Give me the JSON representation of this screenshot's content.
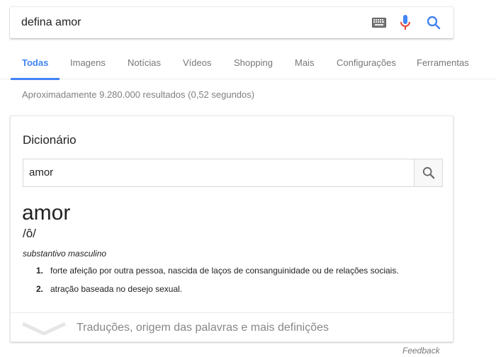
{
  "search": {
    "query": "defina amor"
  },
  "icons": {
    "keyboard": "keyboard-icon",
    "mic": "mic-icon",
    "search": "search-icon"
  },
  "tabs": [
    {
      "label": "Todas",
      "active": true
    },
    {
      "label": "Imagens",
      "active": false
    },
    {
      "label": "Notícias",
      "active": false
    },
    {
      "label": "Vídeos",
      "active": false
    },
    {
      "label": "Shopping",
      "active": false
    },
    {
      "label": "Mais",
      "active": false
    },
    {
      "label": "Configurações",
      "active": false
    },
    {
      "label": "Ferramentas",
      "active": false
    }
  ],
  "stats": "Aproximadamente 9.280.000 resultados (0,52 segundos)",
  "dictionary": {
    "title": "Dicionário",
    "input_value": "amor",
    "headword": "amor",
    "phonetic": "/ô/",
    "part_of_speech": "substantivo masculino",
    "definitions": [
      {
        "num": "1.",
        "text": "forte afeição por outra pessoa, nascida de laços de consanguinidade ou de relações sociais."
      },
      {
        "num": "2.",
        "text": "atração baseada no desejo sexual."
      }
    ],
    "more_label": "Traduções, origem das palavras e mais definições"
  },
  "feedback_label": "Feedback",
  "colors": {
    "accent": "#4285f4",
    "mic_blue": "#4285f4",
    "mic_red": "#ea4335"
  }
}
